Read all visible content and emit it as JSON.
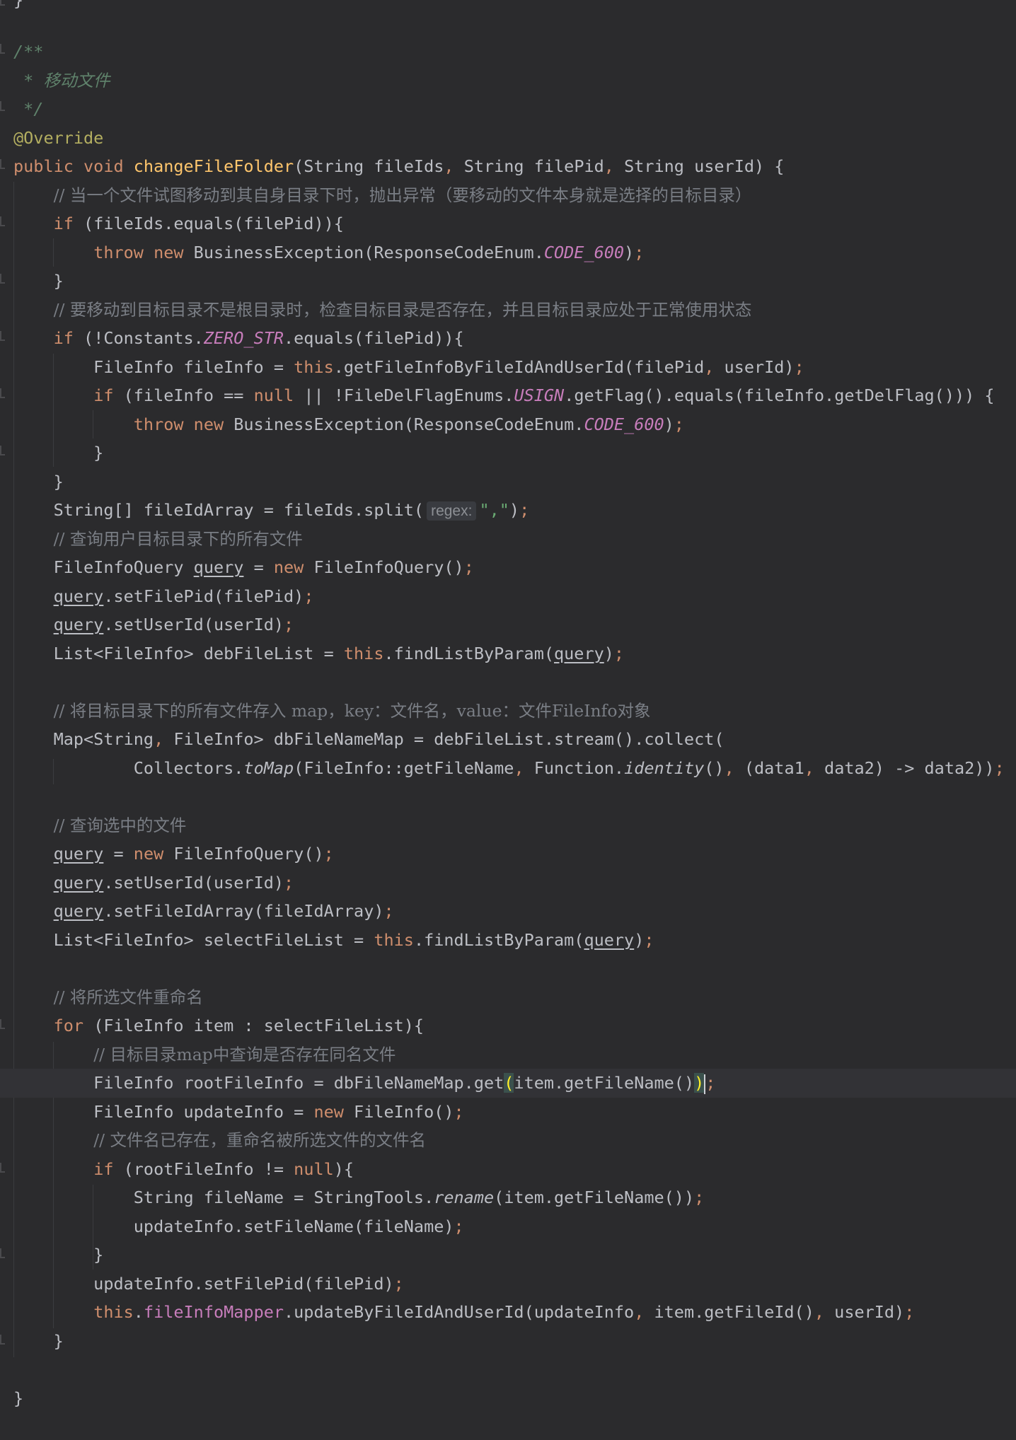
{
  "editor": {
    "theme_colors": {
      "background": "#2b2b2d",
      "keyword": "#cf8e6d",
      "comment": "#7a7e85",
      "doc_comment": "#5f826b",
      "annotation": "#b3ae60",
      "constant": "#c77dbb",
      "method_declaration": "#ffc66d",
      "string": "#6aab73"
    },
    "lines": [
      {
        "id": "l1",
        "text": "/**"
      },
      {
        "id": "l2",
        "text": " * 移动文件"
      },
      {
        "id": "l3",
        "text": " */"
      },
      {
        "id": "l4",
        "text": "@Override"
      },
      {
        "id": "l5",
        "text": "public void changeFileFolder(String fileIds, String filePid, String userId) {"
      },
      {
        "id": "l6",
        "text": "    // 当一个文件试图移动到其自身目录下时，抛出异常（要移动的文件本身就是选择的目标目录）"
      },
      {
        "id": "l7",
        "text": "    if (fileIds.equals(filePid)){"
      },
      {
        "id": "l8",
        "text": "        throw new BusinessException(ResponseCodeEnum.CODE_600);"
      },
      {
        "id": "l9",
        "text": "    }"
      },
      {
        "id": "l10",
        "text": "    // 要移动到目标目录不是根目录时，检查目标目录是否存在，并且目标目录应处于正常使用状态"
      },
      {
        "id": "l11",
        "text": "    if (!Constants.ZERO_STR.equals(filePid)){"
      },
      {
        "id": "l12",
        "text": "        FileInfo fileInfo = this.getFileInfoByFileIdAndUserId(filePid, userId);"
      },
      {
        "id": "l13",
        "text": "        if (fileInfo == null || !FileDelFlagEnums.USIGN.getFlag().equals(fileInfo.getDelFlag())) {"
      },
      {
        "id": "l14",
        "text": "            throw new BusinessException(ResponseCodeEnum.CODE_600);"
      },
      {
        "id": "l15",
        "text": "        }"
      },
      {
        "id": "l16",
        "text": "    }"
      },
      {
        "id": "l17",
        "text": "    String[] fileIdArray = fileIds.split( regex: \",\");",
        "hint": "regex:"
      },
      {
        "id": "l18",
        "text": "    // 查询用户目标目录下的所有文件"
      },
      {
        "id": "l19",
        "text": "    FileInfoQuery query = new FileInfoQuery();"
      },
      {
        "id": "l20",
        "text": "    query.setFilePid(filePid);"
      },
      {
        "id": "l21",
        "text": "    query.setUserId(userId);"
      },
      {
        "id": "l22",
        "text": "    List<FileInfo> debFileList = this.findListByParam(query);"
      },
      {
        "id": "l23",
        "text": ""
      },
      {
        "id": "l24",
        "text": "    // 将目标目录下的所有文件存入 map，key：文件名，value：文件FileInfo对象"
      },
      {
        "id": "l25",
        "text": "    Map<String, FileInfo> dbFileNameMap = debFileList.stream().collect("
      },
      {
        "id": "l26",
        "text": "            Collectors.toMap(FileInfo::getFileName, Function.identity(), (data1, data2) -> data2));"
      },
      {
        "id": "l27",
        "text": ""
      },
      {
        "id": "l28",
        "text": "    // 查询选中的文件"
      },
      {
        "id": "l29",
        "text": "    query = new FileInfoQuery();"
      },
      {
        "id": "l30",
        "text": "    query.setUserId(userId);"
      },
      {
        "id": "l31",
        "text": "    query.setFileIdArray(fileIdArray);"
      },
      {
        "id": "l32",
        "text": "    List<FileInfo> selectFileList = this.findListByParam(query);"
      },
      {
        "id": "l33",
        "text": ""
      },
      {
        "id": "l34",
        "text": "    // 将所选文件重命名"
      },
      {
        "id": "l35",
        "text": "    for (FileInfo item : selectFileList){"
      },
      {
        "id": "l36",
        "text": "        // 目标目录map中查询是否存在同名文件"
      },
      {
        "id": "l37",
        "text": "        FileInfo rootFileInfo = dbFileNameMap.get(item.getFileName());"
      },
      {
        "id": "l38",
        "text": "        FileInfo updateInfo = new FileInfo();"
      },
      {
        "id": "l39",
        "text": "        // 文件名已存在，重命名被所选文件的文件名"
      },
      {
        "id": "l40",
        "text": "        if (rootFileInfo != null){"
      },
      {
        "id": "l41",
        "text": "            String fileName = StringTools.rename(item.getFileName());"
      },
      {
        "id": "l42",
        "text": "            updateInfo.setFileName(fileName);"
      },
      {
        "id": "l43",
        "text": "        }"
      },
      {
        "id": "l44",
        "text": "        updateInfo.setFilePid(filePid);"
      },
      {
        "id": "l45",
        "text": "        this.fileInfoMapper.updateByFileIdAndUserId(updateInfo, item.getFileId(), userId);"
      },
      {
        "id": "l46",
        "text": "    }"
      },
      {
        "id": "l47",
        "text": ""
      },
      {
        "id": "l48",
        "text": "}"
      }
    ]
  }
}
